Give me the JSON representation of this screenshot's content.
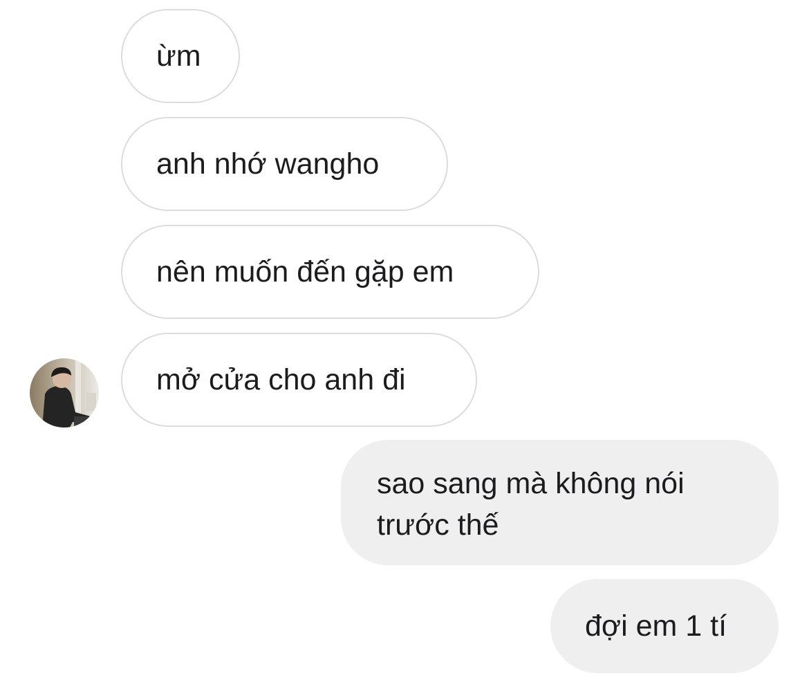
{
  "messages": [
    {
      "id": 1,
      "direction": "incoming",
      "text": "ừm"
    },
    {
      "id": 2,
      "direction": "incoming",
      "text": "anh nhớ wangho"
    },
    {
      "id": 3,
      "direction": "incoming",
      "text": "nên muốn đến gặp em"
    },
    {
      "id": 4,
      "direction": "incoming",
      "text": "mở cửa cho anh đi"
    },
    {
      "id": 5,
      "direction": "outgoing",
      "text": "sao sang mà không nói trước thế"
    },
    {
      "id": 6,
      "direction": "outgoing",
      "text": "đợi em 1 tí"
    }
  ],
  "avatar": {
    "icon": "contact-photo"
  },
  "colors": {
    "background": "#ffffff",
    "incoming_border": "#dcdcdc",
    "outgoing_fill": "#efefef",
    "text": "#1c1c1e"
  }
}
